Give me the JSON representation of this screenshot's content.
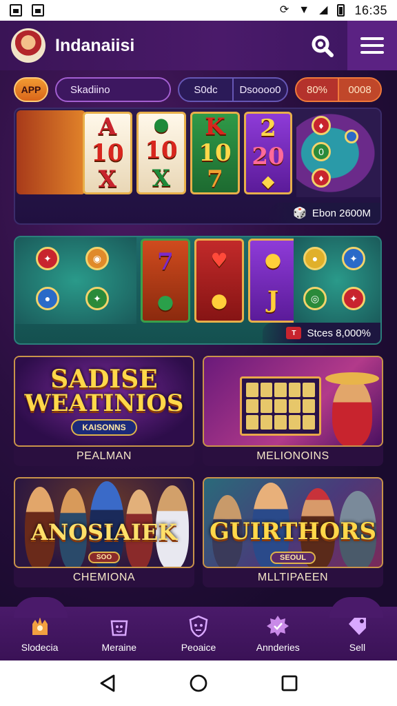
{
  "status_bar": {
    "time": "16:35"
  },
  "header": {
    "title": "Indanaiisi"
  },
  "filters": {
    "app_label": "APP",
    "search_value": "Skadiino",
    "option_left": "S0dc",
    "option_right": "Dsoooo0",
    "stat_left": "80%",
    "stat_right": "0008"
  },
  "banners": [
    {
      "reels": [
        [
          "A",
          "10",
          "X"
        ],
        [
          "",
          "10",
          "X"
        ],
        [
          "K",
          "10",
          "7"
        ],
        [
          "2",
          "20",
          ""
        ]
      ],
      "info": "Ebon 2600M"
    },
    {
      "info": "Stces 8,000%"
    }
  ],
  "games": [
    {
      "label": "PEALMAN",
      "art_title_line1": "SADISE",
      "art_title_line2": "WEATINIOS",
      "art_subtitle": "KAISONNS"
    },
    {
      "label": "MELIONOINS"
    },
    {
      "label": "CHEMIONA",
      "art_title_line1": "ANOSIAIEK",
      "art_subtitle": "SOO"
    },
    {
      "label": "MLLTIPAEEN",
      "art_title_line1": "GUIRTHORS",
      "art_subtitle": "SEOUL"
    }
  ],
  "bottom_nav": [
    {
      "label": "Slodecia",
      "icon": "castle-icon"
    },
    {
      "label": "Meraine",
      "icon": "gift-icon"
    },
    {
      "label": "Peoaice",
      "icon": "shield-icon"
    },
    {
      "label": "Annderies",
      "icon": "badge-icon"
    },
    {
      "label": "Sell",
      "icon": "tag-icon"
    }
  ],
  "colors": {
    "header_bg": "#4a1a6a",
    "accent_orange": "#f29a32",
    "gold": "#ffd84a",
    "nav_bg": "#4a1a6a"
  }
}
